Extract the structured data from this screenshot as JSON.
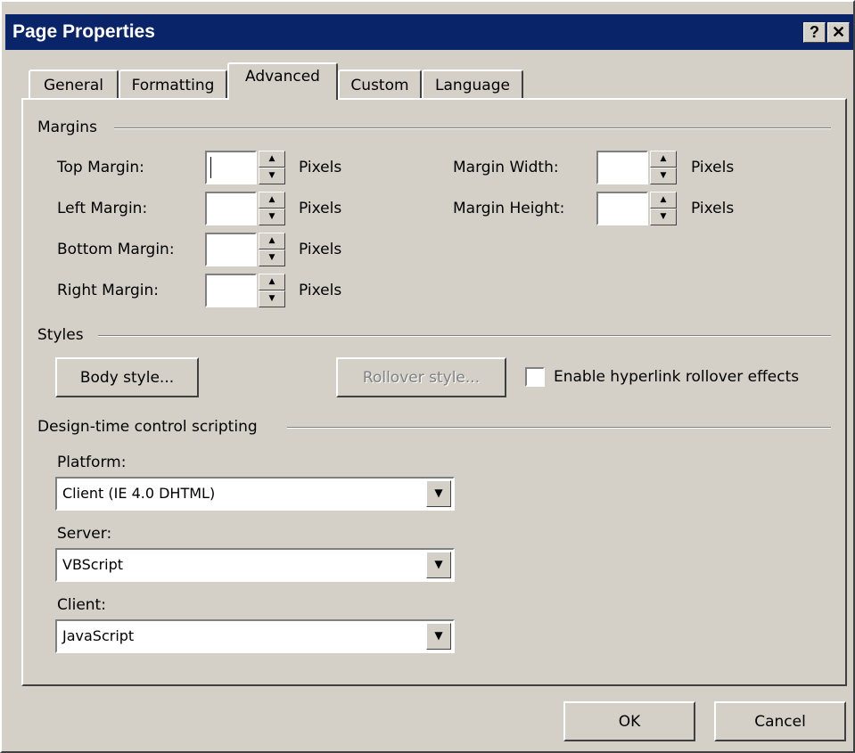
{
  "window": {
    "title": "Page Properties",
    "help_glyph": "?",
    "close_glyph": "✕"
  },
  "tabs": [
    {
      "label": "General",
      "active": false
    },
    {
      "label": "Formatting",
      "active": false
    },
    {
      "label": "Advanced",
      "active": true
    },
    {
      "label": "Custom",
      "active": false
    },
    {
      "label": "Language",
      "active": false
    }
  ],
  "margins": {
    "group_label": "Margins",
    "unit": "Pixels",
    "top": {
      "label": "Top Margin:",
      "value": ""
    },
    "left": {
      "label": "Left Margin:",
      "value": ""
    },
    "bottom": {
      "label": "Bottom Margin:",
      "value": ""
    },
    "right": {
      "label": "Right Margin:",
      "value": ""
    },
    "width": {
      "label": "Margin Width:",
      "value": ""
    },
    "height": {
      "label": "Margin Height:",
      "value": ""
    }
  },
  "styles": {
    "group_label": "Styles",
    "body_style_label": "Body style...",
    "rollover_style_label": "Rollover style...",
    "rollover_enabled": false,
    "rollover_checkbox_label": "Enable hyperlink rollover effects",
    "rollover_checked": false
  },
  "scripting": {
    "group_label": "Design-time control scripting",
    "platform": {
      "label": "Platform:",
      "value": "Client (IE 4.0 DHTML)"
    },
    "server": {
      "label": "Server:",
      "value": "VBScript"
    },
    "client": {
      "label": "Client:",
      "value": "JavaScript"
    }
  },
  "footer": {
    "ok_label": "OK",
    "cancel_label": "Cancel"
  },
  "colors": {
    "titlebar": "#0a246a",
    "face": "#d4d0c8"
  },
  "icons": {
    "spin_up": "up-arrow-icon",
    "spin_down": "down-arrow-icon",
    "dropdown": "down-arrow-icon"
  },
  "glyphs": {
    "up": "▲",
    "down": "▼"
  }
}
